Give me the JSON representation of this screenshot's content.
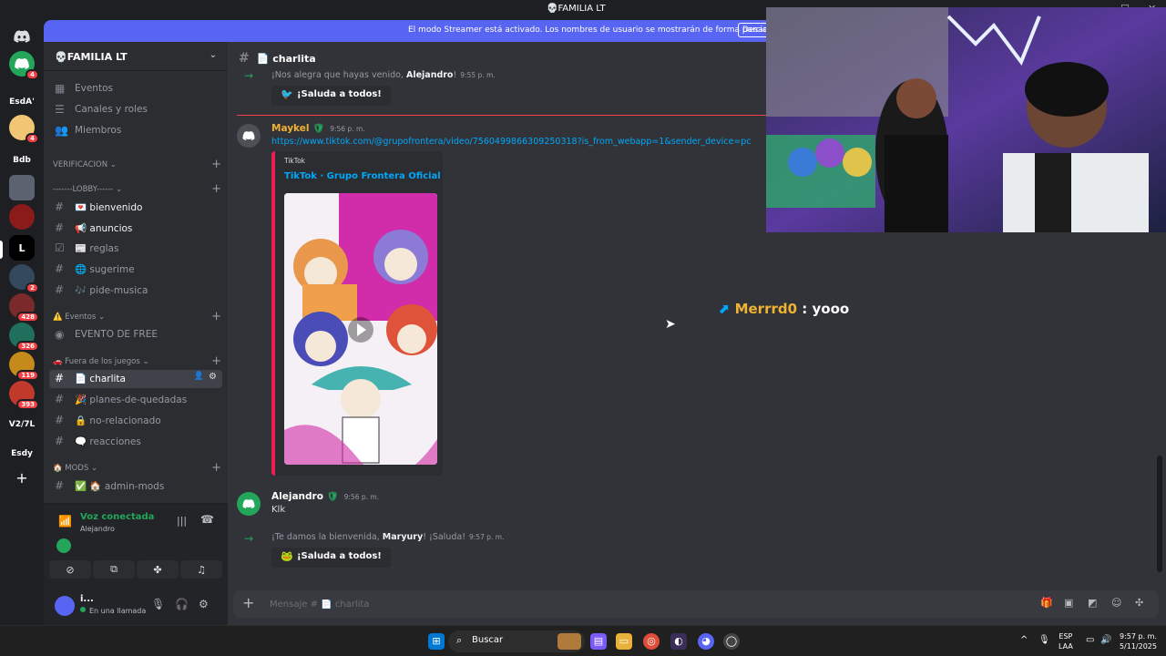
{
  "window": {
    "title": "💀FAMILIA LT",
    "minimize": "—",
    "maximize": "☐",
    "close": "✕"
  },
  "guilds": {
    "home_icon": "discord-icon",
    "badges": [
      "4",
      "4",
      "2",
      "428",
      "326",
      "119",
      "393"
    ],
    "labels": [
      "EsdA'",
      "Bdb",
      "V2/7L",
      "Esdy"
    ],
    "add": "+"
  },
  "streamer_banner": {
    "text": "El modo Streamer está activado. Los nombres de usuario se mostrarán de forma parcial.",
    "button": "Desactivar"
  },
  "server": {
    "name": "💀FAMILIA LT"
  },
  "sidebar": {
    "top_items": [
      "Eventos",
      "Canales y roles",
      "Miembros"
    ],
    "categories": [
      "VERIFICACION",
      "-------LOBBY------",
      "⚠️ Eventos",
      "🚗 Fuera de los juegos",
      "🏠 MODS"
    ],
    "channels": [
      "💌 bienvenido",
      "📢 anuncios",
      "📰 reglas",
      "🌐 sugerime",
      "🎶 pide-musica",
      "EVENTO DE FREE",
      "📄 charlita",
      "🎉 planes-de-quedadas",
      "🔒 no-relacionado",
      "🗨️ reacciones",
      "✅ 🏠 admin-mods"
    ]
  },
  "voice": {
    "status": "Voz conectada",
    "channel": "Alejandro"
  },
  "user": {
    "name": "i...",
    "status": "En una llamada"
  },
  "channel": {
    "name": "📄 charlita"
  },
  "messages": {
    "sys1": {
      "pre": "¡Nos alegra que hayas venido, ",
      "user": "Alejandro",
      "post": "!",
      "time": "9:55 p. m."
    },
    "wave1": "¡Saluda a todos!",
    "maykel": {
      "author": "Maykel",
      "time": "9:56 p. m.",
      "link": "https://www.tiktok.com/@grupofrontera/video/7560499866309250318?is_from_webapp=1&sender_device=pc",
      "embed_provider": "TikTok",
      "embed_title": "TikTok · Grupo Frontera Oficial"
    },
    "alejandro": {
      "author": "Alejandro",
      "time": "9:56 p. m.",
      "text": "Klk"
    },
    "sys2": {
      "pre": "¡Te damos la bienvenida, ",
      "user": "Maryury",
      "post": "! ¡Saluda!",
      "time": "9:57 p. m."
    },
    "wave2": "¡Saluda a todos!"
  },
  "overlay": {
    "name": "Merrrd0",
    "sep": " : ",
    "text": "yooo"
  },
  "composer": {
    "placeholder": "Mensaje # 📄 charlita"
  },
  "taskbar": {
    "search": "Buscar",
    "lang": "ESP",
    "lang2": "LAA",
    "time": "9:57 p. m.",
    "date": "5/11/2025"
  },
  "colors": {
    "accent": "#5865f2",
    "online": "#23a55a",
    "link": "#00a8fc",
    "tiktok": "#ee1d52"
  }
}
